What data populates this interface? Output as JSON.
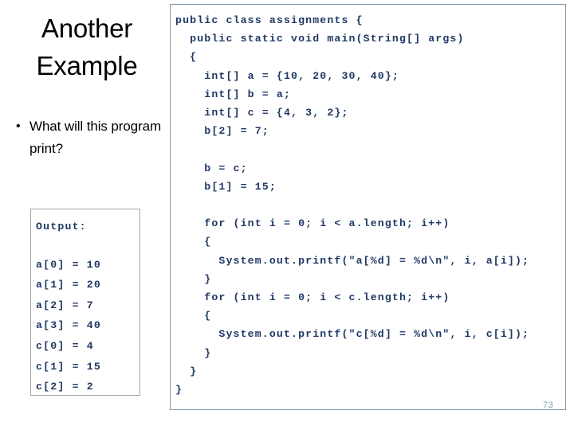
{
  "slide": {
    "title": "Another Example",
    "page_number": "73",
    "text_color": "#000000",
    "code_color": "#1f3864",
    "border_color": "#7f9aa6",
    "output_border_color": "#a6a6a6",
    "page_number_color": "#7f9aa6"
  },
  "bullets": [
    {
      "marker": "•",
      "text": "What will this program print?"
    }
  ],
  "output_panel": {
    "heading": "Output:",
    "lines": [
      "a[0] = 10",
      "a[1] = 20",
      "a[2] = 7",
      "a[3] = 40",
      "c[0] = 4",
      "c[1] = 15",
      "c[2] = 2"
    ]
  },
  "code_panel": {
    "language": "java",
    "lines": [
      "public class assignments {",
      "  public static void main(String[] args)",
      "  {",
      "    int[] a = {10, 20, 30, 40};",
      "    int[] b = a;",
      "    int[] c = {4, 3, 2};",
      "    b[2] = 7;",
      "",
      "    b = c;",
      "    b[1] = 15;",
      "",
      "    for (int i = 0; i < a.length; i++)",
      "    {",
      "      System.out.printf(\"a[%d] = %d\\n\", i, a[i]);",
      "    }",
      "    for (int i = 0; i < c.length; i++)",
      "    {",
      "      System.out.printf(\"c[%d] = %d\\n\", i, c[i]);",
      "    }",
      "  }",
      "}"
    ]
  }
}
